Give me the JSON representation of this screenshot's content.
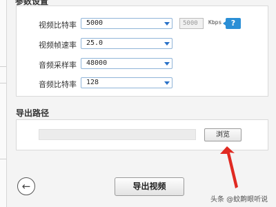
{
  "params": {
    "title": "参数设置",
    "rows": [
      {
        "label": "视频比特率",
        "value": "5000"
      },
      {
        "label": "视频帧速率",
        "value": "25.0"
      },
      {
        "label": "音频采样率",
        "value": "48000"
      },
      {
        "label": "音频比特率",
        "value": "128"
      }
    ],
    "kbps_value": "5000",
    "kbps_unit": "Kbps",
    "help_symbol": "?"
  },
  "export_path": {
    "title": "导出路径",
    "path_value": "",
    "browse_label": "浏览"
  },
  "footer": {
    "back_symbol": "←",
    "export_label": "导出视频",
    "watermark": "头条 @蚊齁眼听说"
  },
  "colors": {
    "accent_blue": "#2b8fd6",
    "annotation_red": "#e02a22"
  },
  "icons": {
    "back": "arrow-left-circle",
    "help": "question-badge",
    "dropdown": "triangle-down"
  }
}
